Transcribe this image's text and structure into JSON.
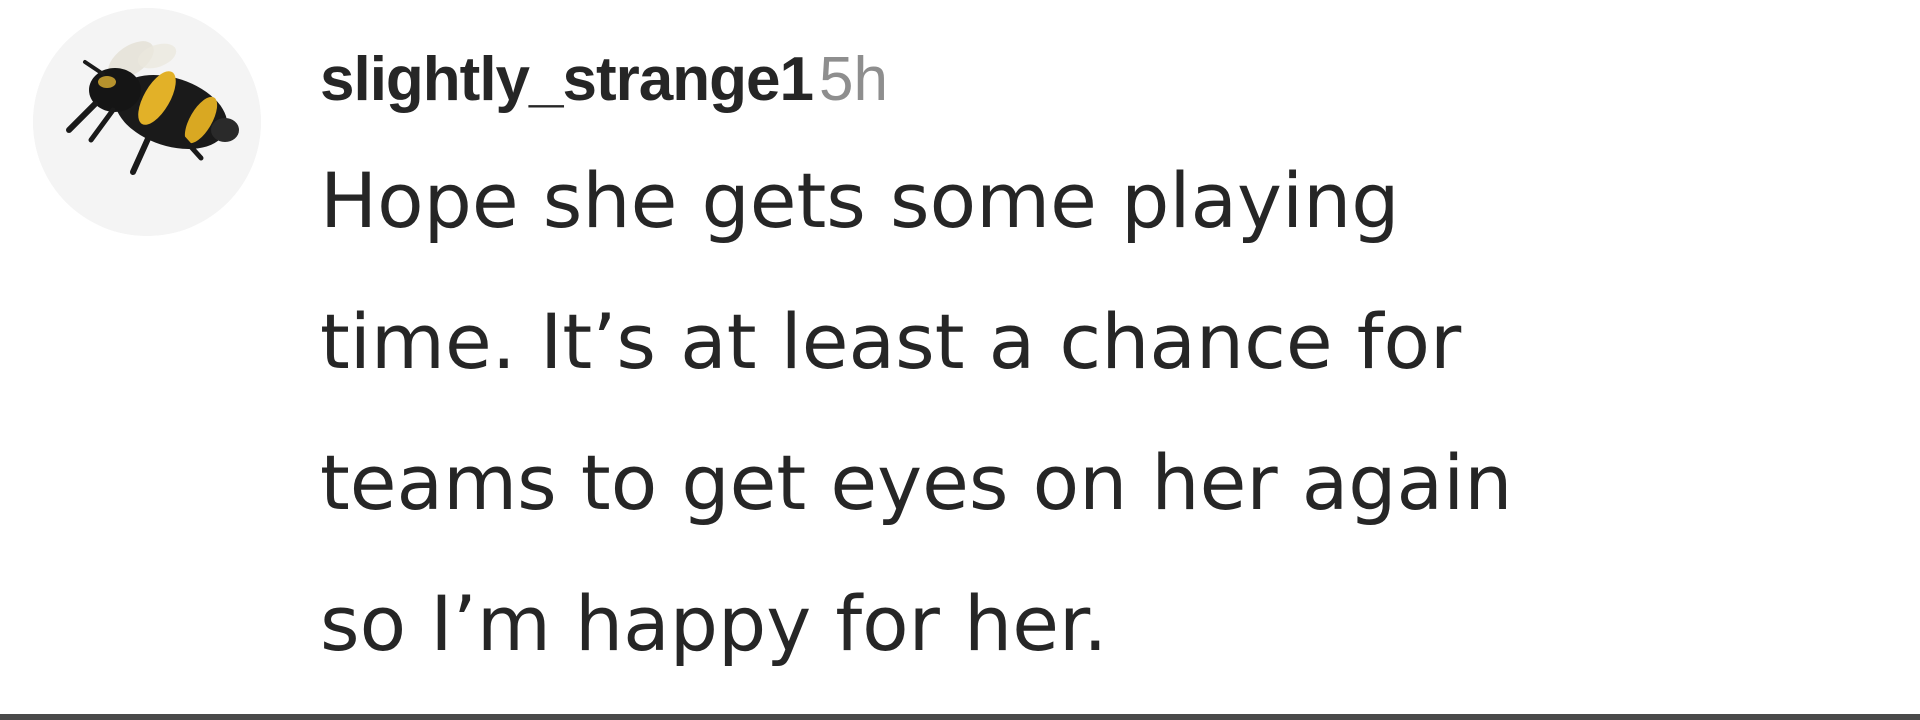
{
  "comment": {
    "avatar_icon": "bumblebee-avatar-icon",
    "username": "slightly_strange1",
    "timestamp": "5h",
    "text_lines": [
      "Hope she gets some playing",
      "time. It’s at least a chance for",
      "teams to get eyes on her again",
      "so I’m happy for her."
    ]
  },
  "colors": {
    "text": "#262626",
    "muted": "#8e8e8e",
    "background": "#ffffff"
  }
}
